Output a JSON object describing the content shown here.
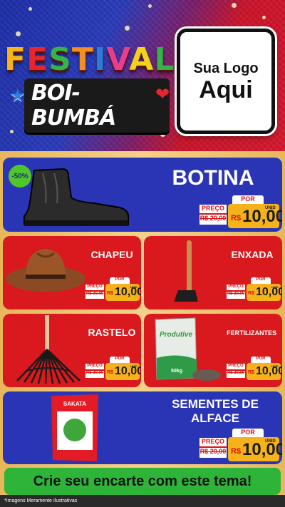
{
  "header": {
    "festival_letters": [
      "F",
      "E",
      "S",
      "T",
      "I",
      "V",
      "A",
      "L"
    ],
    "subtitle": "BOI-BUMBÁ",
    "logo_line1": "Sua Logo",
    "logo_line2": "Aqui"
  },
  "products": {
    "botina": {
      "name": "BOTINA",
      "badge": "-50%",
      "por": "POR",
      "preco": "PREÇO",
      "old": "R$ 20,00",
      "currency": "R$",
      "price": "10,00",
      "unit": "UNID"
    },
    "chapeu": {
      "name": "CHAPEU",
      "por": "POR",
      "preco": "PREÇO",
      "old": "R$ 20,00",
      "currency": "R$",
      "price": "10,00",
      "unit": "UNID"
    },
    "enxada": {
      "name": "ENXADA",
      "por": "POR",
      "preco": "PREÇO",
      "old": "R$ 20,00",
      "currency": "R$",
      "price": "10,00",
      "unit": "UNID"
    },
    "rastelo": {
      "name": "RASTELO",
      "por": "POR",
      "preco": "PREÇO",
      "old": "R$ 20,00",
      "currency": "R$",
      "price": "10,00",
      "unit": "UNID"
    },
    "fertilizantes": {
      "name": "FERTILIZANTES",
      "bag_brand": "Produtive",
      "bag_weight": "50kg",
      "por": "POR",
      "preco": "PREÇO",
      "old": "R$ 20,00",
      "currency": "R$",
      "price": "10,00",
      "unit": "UNID"
    },
    "sementes": {
      "name_line1": "SEMENTES DE",
      "name_line2": "ALFACE",
      "brand": "SAKATA",
      "por": "POR",
      "preco": "PREÇO",
      "old": "R$ 20,00",
      "currency": "R$",
      "price": "10,00",
      "unit": "UNID"
    }
  },
  "footer": {
    "cta": "Crie seu encarte com este tema!",
    "disclaimer": "*Imagens Meramente Ilustrativas"
  },
  "colors": {
    "blue": "#2a35b5",
    "red": "#d9191e",
    "green": "#2fb43a",
    "price_yellow": "#f6b21a"
  }
}
